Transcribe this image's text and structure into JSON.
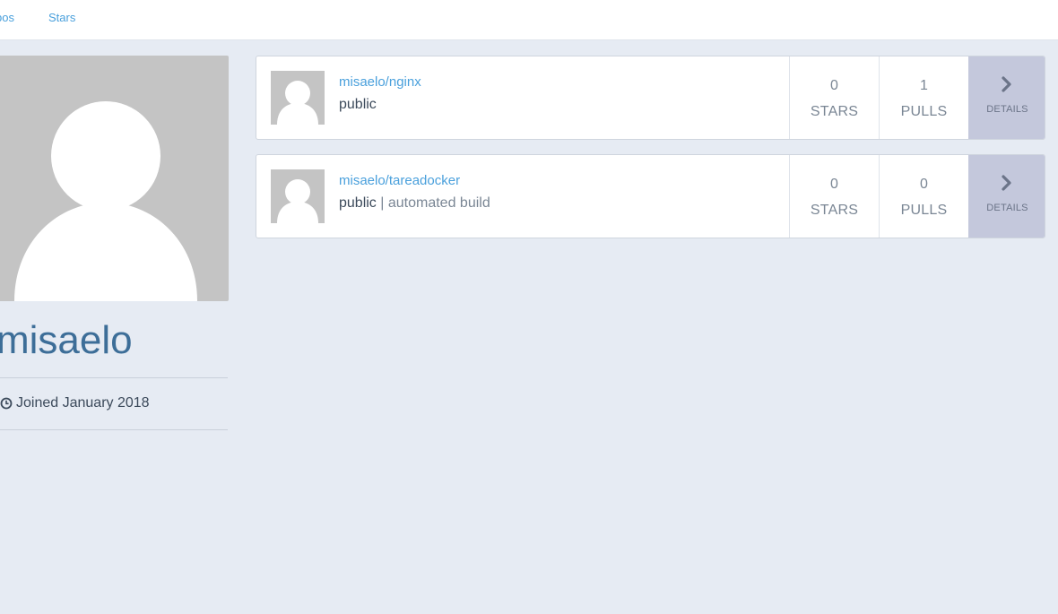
{
  "nav": {
    "tabs": [
      {
        "label": "pos"
      },
      {
        "label": "Stars"
      }
    ]
  },
  "profile": {
    "username": "misaelo",
    "joined": "Joined January 2018",
    "avatar_icon": "default-user-avatar-icon",
    "joined_icon": "clock-icon"
  },
  "repos": [
    {
      "name": "misaelo/nginx",
      "visibility": "public",
      "separator": "",
      "build": "",
      "stars": "0",
      "stars_label": "STARS",
      "pulls": "1",
      "pulls_label": "PULLS",
      "details_label": "DETAILS"
    },
    {
      "name": "misaelo/tareadocker",
      "visibility": "public",
      "separator": " | ",
      "build": "automated build",
      "stars": "0",
      "stars_label": "STARS",
      "pulls": "0",
      "pulls_label": "PULLS",
      "details_label": "DETAILS"
    }
  ],
  "colors": {
    "link": "#4aa0dc",
    "username": "#3d6e98",
    "page_bg": "#e6ebf3",
    "details_bg": "#c4c8dc"
  }
}
